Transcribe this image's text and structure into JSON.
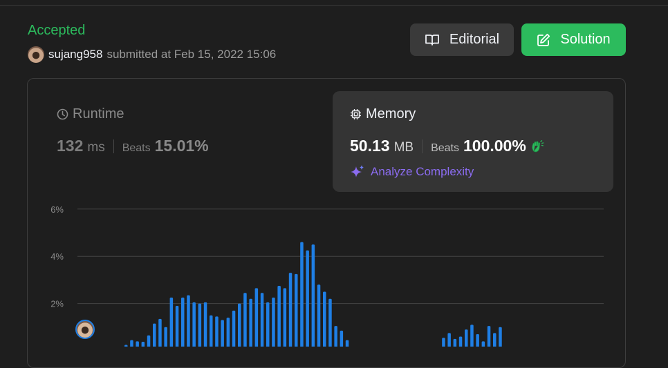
{
  "header": {
    "status": "Accepted",
    "username": "sujang958",
    "submitted_text": "submitted at Feb 15, 2022 15:06"
  },
  "buttons": {
    "editorial_label": "Editorial",
    "solution_label": "Solution"
  },
  "runtime": {
    "label": "Runtime",
    "value": "132",
    "unit": "ms",
    "beats_label": "Beats",
    "beats_pct": "15.01%"
  },
  "memory": {
    "label": "Memory",
    "value": "50.13",
    "unit": "MB",
    "beats_label": "Beats",
    "beats_pct": "100.00%"
  },
  "analyze_label": "Analyze Complexity",
  "colors": {
    "accepted": "#2cbb5d",
    "bar": "#1f7fe5",
    "analyze": "#8b6cf0"
  },
  "chart_data": {
    "type": "bar",
    "y_ticks": [
      "6%",
      "4%",
      "2%"
    ],
    "ylim": [
      0,
      6
    ],
    "grid": true,
    "values": [
      0.05,
      0.05,
      0.05,
      0.05,
      0.05,
      0.25,
      0.45,
      0.4,
      0.38,
      0.65,
      1.15,
      1.35,
      1.0,
      2.25,
      1.9,
      2.25,
      2.35,
      2.05,
      2.0,
      2.05,
      1.5,
      1.45,
      1.3,
      1.4,
      1.7,
      2.0,
      2.45,
      2.2,
      2.65,
      2.45,
      2.05,
      2.25,
      2.75,
      2.65,
      3.3,
      3.25,
      4.6,
      4.25,
      4.5,
      2.8,
      2.5,
      2.2,
      1.05,
      0.85,
      0.45,
      0.1,
      0.05,
      0.05,
      0.05,
      0.05,
      0.05,
      0.05,
      0.05,
      0.05,
      0.05,
      0.05,
      0.05,
      0.1,
      0.1,
      0.15,
      0.15,
      0.55,
      0.75,
      0.5,
      0.6,
      0.9,
      1.1,
      0.7,
      0.4,
      1.05,
      0.75,
      1.0
    ]
  }
}
